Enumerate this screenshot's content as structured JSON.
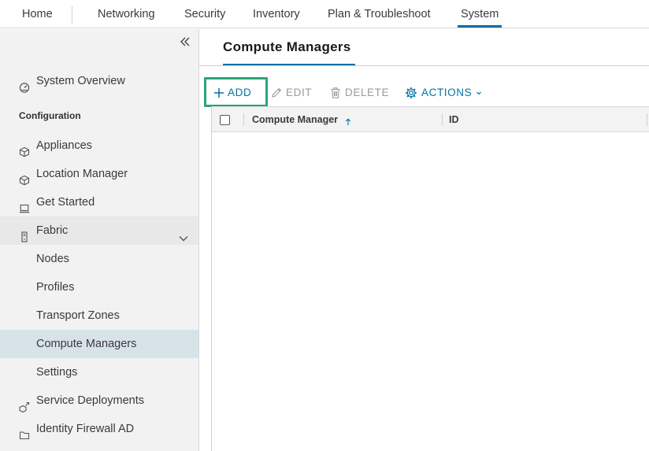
{
  "topnav": {
    "items": [
      "Home",
      "Networking",
      "Security",
      "Inventory",
      "Plan & Troubleshoot",
      "System"
    ],
    "active": "System"
  },
  "sidebar": {
    "system_overview": "System Overview",
    "config_heading": "Configuration",
    "items": {
      "appliances": "Appliances",
      "location_manager": "Location Manager",
      "get_started": "Get Started",
      "fabric": "Fabric",
      "nodes": "Nodes",
      "profiles": "Profiles",
      "transport_zones": "Transport Zones",
      "compute_managers": "Compute Managers",
      "settings": "Settings",
      "service_deployments": "Service Deployments",
      "identity_firewall_ad": "Identity Firewall AD"
    },
    "selected": "compute_managers"
  },
  "main": {
    "title": "Compute Managers",
    "toolbar": {
      "add": "ADD",
      "edit": "EDIT",
      "delete": "DELETE",
      "actions": "ACTIONS"
    },
    "grid": {
      "columns": [
        "Compute Manager",
        "ID"
      ],
      "sort_direction": "ascending"
    }
  },
  "colors": {
    "accent": "#0072a3",
    "highlight": "#2aa57b",
    "selected_row": "#d8e3e9"
  }
}
